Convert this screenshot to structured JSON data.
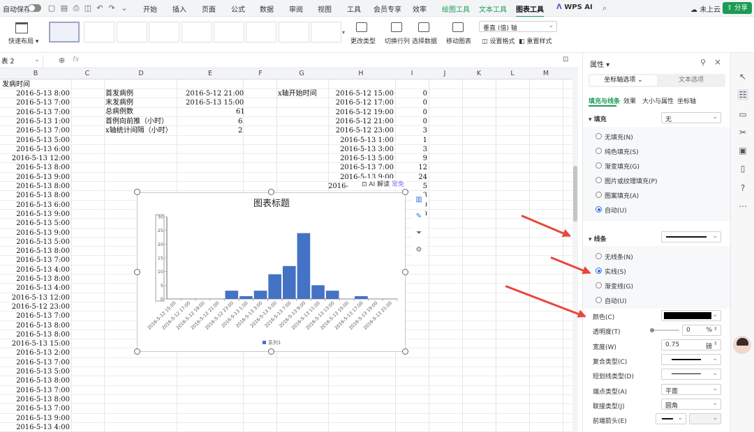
{
  "menubar": {
    "autosave_label": "自动保存",
    "tabs": [
      "开始",
      "插入",
      "页面",
      "公式",
      "数据",
      "审阅",
      "视图",
      "工具",
      "会员专享",
      "效率"
    ],
    "context_tabs": [
      "绘图工具",
      "文本工具",
      "图表工具"
    ],
    "active_tab": "图表工具",
    "wps_ai": "WPS AI",
    "cloud_status": "未上云",
    "share_label": "分享"
  },
  "toolbar": {
    "quick_layout": "快速布局",
    "change_type": "更改类型",
    "switch_rowcol": "切换行列",
    "select_data": "选择数据",
    "move_chart": "移动图表",
    "axis_select": "垂直 (值) 轴",
    "set_format": "设置格式",
    "reset_style": "重置样式"
  },
  "formulabar": {
    "name_box": "表 2",
    "fx": "fx"
  },
  "columns": [
    "B",
    "C",
    "D",
    "E",
    "F",
    "G",
    "H",
    "I",
    "J",
    "K",
    "L",
    "M"
  ],
  "sheet": {
    "b_header": "发病时间",
    "b_values": [
      "2016-5-13  8:00",
      "2016-5-13  7:00",
      "2016-5-13  7:00",
      "2016-5-13  1:00",
      "2016-5-13  7:00",
      "2016-5-13  5:00",
      "2016-5-13  6:00",
      "2016-5-13  12:00",
      "2016-5-13  8:00",
      "2016-5-13  9:00",
      "2016-5-13  8:00",
      "2016-5-13  8:00",
      "2016-5-13  6:00",
      "2016-5-13  9:00",
      "2016-5-13  5:00",
      "2016-5-13  9:00",
      "2016-5-13  5:00",
      "2016-5-13  8:00",
      "2016-5-13  7:00",
      "2016-5-13  4:00",
      "2016-5-13  8:00",
      "2016-5-13  4:00",
      "2016-5-13  12:00",
      "2016-5-12  23:00",
      "2016-5-13  7:00",
      "2016-5-13  8:00",
      "2016-5-13  8:00",
      "2016-5-13  15:00",
      "2016-5-13  2:00",
      "2016-5-13  7:00",
      "2016-5-13  5:00",
      "2016-5-13  8:00",
      "2016-5-13  7:00",
      "2016-5-13  8:00",
      "2016-5-13  7:00",
      "2016-5-13  9:00",
      "2016-5-13  4:00",
      "2016-5-13  4:00"
    ],
    "d_labels": [
      "首发病例",
      "末发病例",
      "总病例数",
      "首例向前推（小时）",
      "x轴统计间隔（小时）"
    ],
    "e_values": [
      "2016-5-12  21:00",
      "2016-5-13  15:00",
      "61",
      "6",
      "2"
    ],
    "g_label": "x轴开始时间",
    "h_values": [
      "2016-5-12  15:00",
      "2016-5-12  17:00",
      "2016-5-12  19:00",
      "2016-5-12  21:00",
      "2016-5-12  23:00",
      "2016-5-13  1:00",
      "2016-5-13  3:00",
      "2016-5-13  5:00",
      "2016-5-13  7:00",
      "2016-5-13  9:00",
      "2016-"
    ],
    "i_values": [
      "0",
      "0",
      "0",
      "0",
      "3",
      "1",
      "3",
      "9",
      "12",
      "24",
      "5",
      "3",
      "0",
      "0"
    ]
  },
  "chart_data": {
    "type": "bar",
    "title": "图表标题",
    "categories": [
      "2016-5-12 15:00",
      "2016-5-12 17:00",
      "2016-5-12 19:00",
      "2016-5-12 21:00",
      "2016-5-12 23:00",
      "2016-5-13 1:00",
      "2016-5-13 3:00",
      "2016-5-13 5:00",
      "2016-5-13 7:00",
      "2016-5-13 9:00",
      "2016-5-13 11:00",
      "2016-5-13 13:00",
      "2016-5-13 15:00",
      "2016-5-13 17:00",
      "2016-5-13 19:00",
      "2016-5-13 21:00"
    ],
    "series": [
      {
        "name": "系列1",
        "values": [
          0,
          0,
          0,
          0,
          3,
          1,
          3,
          9,
          12,
          24,
          5,
          3,
          0,
          1,
          0,
          0
        ]
      }
    ],
    "ylim": [
      0,
      30
    ],
    "yticks": [
      "0",
      "5",
      "10",
      "15",
      "20",
      "25",
      "30"
    ],
    "legend": "bottom",
    "grid": false,
    "bar_color": "#4472c4"
  },
  "ai_badge": {
    "label": "AI 解读",
    "tag": "常免"
  },
  "panel": {
    "title": "属性",
    "tab_axis": "坐标轴选项",
    "tab_text": "文本选项",
    "subtabs": [
      "填充与线条",
      "效果",
      "大小与属性",
      "坐标轴"
    ],
    "fill_section": "填充",
    "fill_value": "无",
    "fill_options": [
      "无填充(N)",
      "纯色填充(S)",
      "渐变填充(G)",
      "图片或纹理填充(P)",
      "图案填充(A)",
      "自动(U)"
    ],
    "line_section": "线条",
    "line_options": [
      "无线条(N)",
      "实线(S)",
      "渐变线(G)",
      "自动(U)"
    ],
    "color_label": "颜色(C)",
    "transparency_label": "透明度(T)",
    "transparency_value": "0",
    "transparency_unit": "%",
    "width_label": "宽度(W)",
    "width_value": "0.75",
    "width_unit": "磅",
    "compound_label": "复合类型(C)",
    "dash_label": "短划线类型(D)",
    "cap_label": "端点类型(A)",
    "cap_value": "平面",
    "join_label": "联接类型(J)",
    "join_value": "圆角",
    "arrow_label": "前端箭头(E)"
  },
  "colors": {
    "accent": "#1b9b54",
    "selection": "#2f6fdb",
    "arrow": "#e8473d"
  }
}
